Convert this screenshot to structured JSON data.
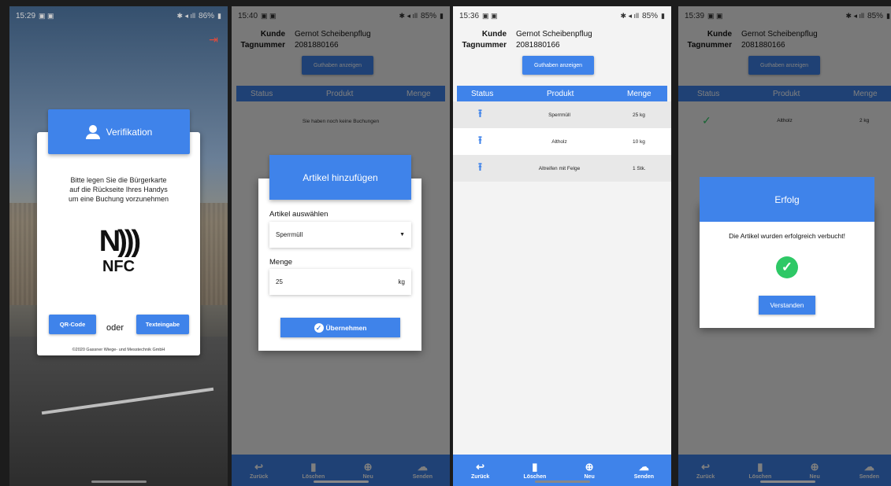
{
  "screens": {
    "verification": {
      "status_time": "15:29",
      "status_right": "86%",
      "header_title": "Verifikation",
      "instruction_lines": [
        "Bitte legen Sie die Bürgerkarte",
        "auf die Rückseite Ihres Handys",
        "um eine Buchung vorzunehmen"
      ],
      "nfc_label": "NFC",
      "qr_button": "QR-Code",
      "or_text": "oder",
      "text_button": "Texteingabe",
      "copyright": "©2020 Gassner Wiege- und Messtechnik GmbH"
    },
    "add_article": {
      "status_time": "15:40",
      "status_right": "85%",
      "customer_label": "Kunde",
      "customer_name": "Gernot Scheibenpflug",
      "tag_label": "Tagnummer",
      "tag_number": "2081880166",
      "balance_button": "Guthaben anzeigen",
      "col_status": "Status",
      "col_product": "Produkt",
      "col_quantity": "Menge",
      "empty_message": "Sie haben noch keine Buchungen",
      "dialog_title": "Artikel hinzufügen",
      "select_label": "Artikel auswählen",
      "select_value": "Sperrmüll",
      "quantity_label": "Menge",
      "quantity_value": "25",
      "quantity_unit": "kg",
      "confirm_button": "Übernehmen"
    },
    "booking_list": {
      "status_time": "15:36",
      "status_right": "85%",
      "customer_label": "Kunde",
      "customer_name": "Gernot Scheibenpflug",
      "tag_label": "Tagnummer",
      "tag_number": "2081880166",
      "balance_button": "Guthaben anzeigen",
      "col_status": "Status",
      "col_product": "Produkt",
      "col_quantity": "Menge",
      "rows": [
        {
          "product": "Sperrmüll",
          "quantity": "25 kg"
        },
        {
          "product": "Altholz",
          "quantity": "10 kg"
        },
        {
          "product": "Altreifen mit Felge",
          "quantity": "1 Stk."
        }
      ]
    },
    "success": {
      "status_time": "15:39",
      "status_right": "85%",
      "customer_label": "Kunde",
      "customer_name": "Gernot Scheibenpflug",
      "tag_label": "Tagnummer",
      "tag_number": "2081880166",
      "balance_button": "Guthaben anzeigen",
      "col_status": "Status",
      "col_product": "Produkt",
      "col_quantity": "Menge",
      "row_product": "Altholz",
      "row_quantity": "2 kg",
      "dialog_title": "Erfolg",
      "dialog_message": "Die Artikel wurden erfolgreich verbucht!",
      "dialog_button": "Verstanden"
    }
  },
  "bottom_nav": {
    "back": "Zurück",
    "delete": "Löschen",
    "new": "Neu",
    "send": "Senden"
  },
  "colors": {
    "primary": "#3f83ea",
    "success": "#2ec866",
    "logout": "#e24b3b"
  }
}
